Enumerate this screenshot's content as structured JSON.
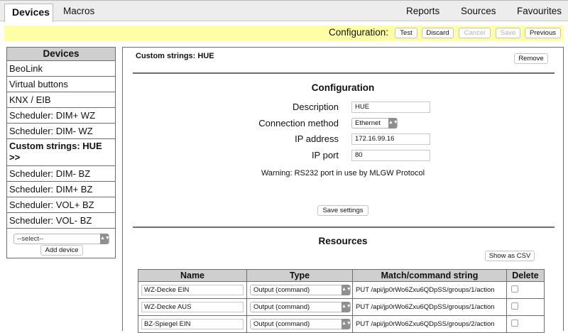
{
  "nav": {
    "left_tabs": [
      "Devices",
      "Macros"
    ],
    "right_tabs": [
      "Reports",
      "Sources",
      "Favourites"
    ]
  },
  "confbar": {
    "label": "Configuration:",
    "buttons": [
      "Test",
      "Discard",
      "Cancel",
      "Save",
      "Previous"
    ]
  },
  "sidebar": {
    "header": "Devices",
    "items": [
      "BeoLink",
      "Virtual buttons",
      "KNX / EIB",
      "Scheduler: DIM+ WZ",
      "Scheduler: DIM- WZ",
      "Custom strings: HUE >>",
      "Scheduler: DIM- BZ",
      "Scheduler: DIM+ BZ",
      "Scheduler: VOL+ BZ",
      "Scheduler: VOL- BZ"
    ],
    "select_value": "--select--",
    "add_button": "Add device"
  },
  "main": {
    "title": "Custom strings: HUE",
    "remove_button": "Remove",
    "configuration": {
      "title": "Configuration",
      "description_label": "Description",
      "description_value": "HUE",
      "connection_label": "Connection method",
      "connection_value": "Ethernet",
      "ip_label": "IP address",
      "ip_value": "172.16.99.16",
      "port_label": "IP port",
      "port_value": "80",
      "warning": "Warning: RS232 port in use by MLGW Protocol",
      "save_button": "Save settings"
    },
    "resources": {
      "title": "Resources",
      "csv_button": "Show as CSV",
      "columns": [
        "Name",
        "Type",
        "Match/command string",
        "Delete"
      ],
      "rows": [
        {
          "name": "WZ-Decke EIN",
          "type": "Output (command)",
          "command": "PUT /api/jp0rWo6Zxu6QDpSS/groups/1/action"
        },
        {
          "name": "WZ-Decke AUS",
          "type": "Output (command)",
          "command": "PUT /api/jp0rWo6Zxu6QDpSS/groups/1/action"
        },
        {
          "name": "BZ-Spiegel EIN",
          "type": "Output (command)",
          "command": "PUT /api/jp0rWo6Zxu6QDpSS/groups/2/action"
        }
      ]
    }
  }
}
